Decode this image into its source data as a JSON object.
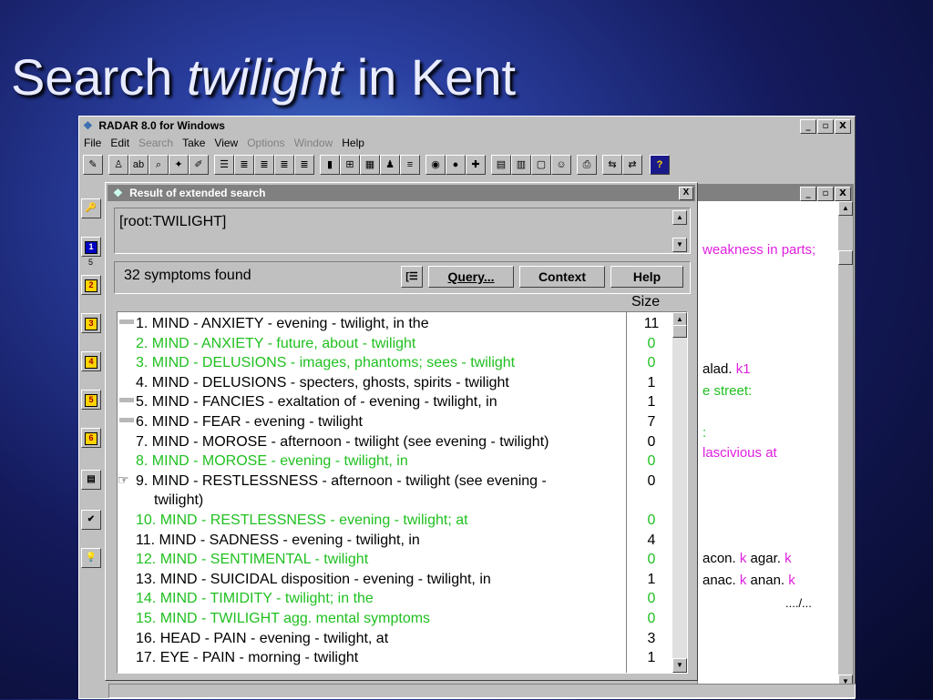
{
  "slide": {
    "title_a": "Search",
    "title_b": "twilight",
    "title_c": "in Kent"
  },
  "window": {
    "title": "RADAR 8.0 for Windows",
    "min": "_",
    "max": "▫",
    "close": "X"
  },
  "menu": [
    "File",
    "Edit",
    "Search",
    "Take",
    "View",
    "Options",
    "Window",
    "Help"
  ],
  "menu_disabled": [
    "Search",
    "Options",
    "Window"
  ],
  "left_tools": [
    "1",
    "2",
    "3",
    "4",
    "5",
    "6"
  ],
  "left_tool_caption": "5",
  "bg_window": {
    "lines": [
      {
        "text": "weakness in parts;",
        "color": "#e020e0"
      },
      {
        "text": "alad.",
        "k": "k1"
      },
      {
        "text": "e street:",
        "color": "#20c020"
      },
      {
        "text": ":",
        "color": "#20c020"
      },
      {
        "text": "lascivious at",
        "color": "#e020e0"
      },
      {
        "text": "acon.",
        "k": "k",
        "t2": "agar.",
        "k2": "k"
      },
      {
        "text": "anac.",
        "k": "k",
        "t2": "anan.",
        "k2": "k"
      },
      {
        "text": "..../..."
      }
    ]
  },
  "dialog": {
    "title": "Result of extended search",
    "query": "[root:TWILIGHT]",
    "found": "32 symptoms found",
    "buttons": {
      "query": "Query...",
      "context": "Context",
      "help": "Help"
    },
    "size_header": "Size",
    "rows": [
      {
        "label": "1. MIND - ANXIETY - evening - twilight, in the",
        "size": "11",
        "color": "black",
        "marker": true
      },
      {
        "label": "2. MIND - ANXIETY - future, about - twilight",
        "size": "0",
        "color": "green"
      },
      {
        "label": "3. MIND - DELUSIONS - images, phantoms; sees - twilight",
        "size": "0",
        "color": "green"
      },
      {
        "label": "4. MIND - DELUSIONS - specters, ghosts, spirits - twilight",
        "size": "1",
        "color": "black"
      },
      {
        "label": "5. MIND - FANCIES - exaltation of - evening - twilight, in",
        "size": "1",
        "color": "black",
        "marker": true
      },
      {
        "label": "6. MIND - FEAR - evening - twilight",
        "size": "7",
        "color": "black",
        "marker": true
      },
      {
        "label": "7. MIND - MOROSE - afternoon - twilight (see evening - twilight)",
        "size": "0",
        "color": "black"
      },
      {
        "label": "8. MIND - MOROSE - evening - twilight, in",
        "size": "0",
        "color": "green"
      },
      {
        "label": "9. MIND - RESTLESSNESS - afternoon - twilight (see evening -",
        "size": "0",
        "color": "black",
        "hand": true
      },
      {
        "label": "twilight)",
        "size": "",
        "color": "black",
        "cont": true
      },
      {
        "label": "10. MIND - RESTLESSNESS - evening - twilight; at",
        "size": "0",
        "color": "green"
      },
      {
        "label": "11. MIND - SADNESS - evening - twilight, in",
        "size": "4",
        "color": "black"
      },
      {
        "label": "12. MIND - SENTIMENTAL - twilight",
        "size": "0",
        "color": "green"
      },
      {
        "label": "13. MIND - SUICIDAL disposition - evening - twilight, in",
        "size": "1",
        "color": "black"
      },
      {
        "label": "14. MIND - TIMIDITY - twilight; in the",
        "size": "0",
        "color": "green"
      },
      {
        "label": "15. MIND - TWILIGHT agg. mental symptoms",
        "size": "0",
        "color": "green"
      },
      {
        "label": "16. HEAD - PAIN - evening - twilight, at",
        "size": "3",
        "color": "black"
      },
      {
        "label": "17. EYE - PAIN - morning - twilight",
        "size": "1",
        "color": "black"
      }
    ]
  }
}
